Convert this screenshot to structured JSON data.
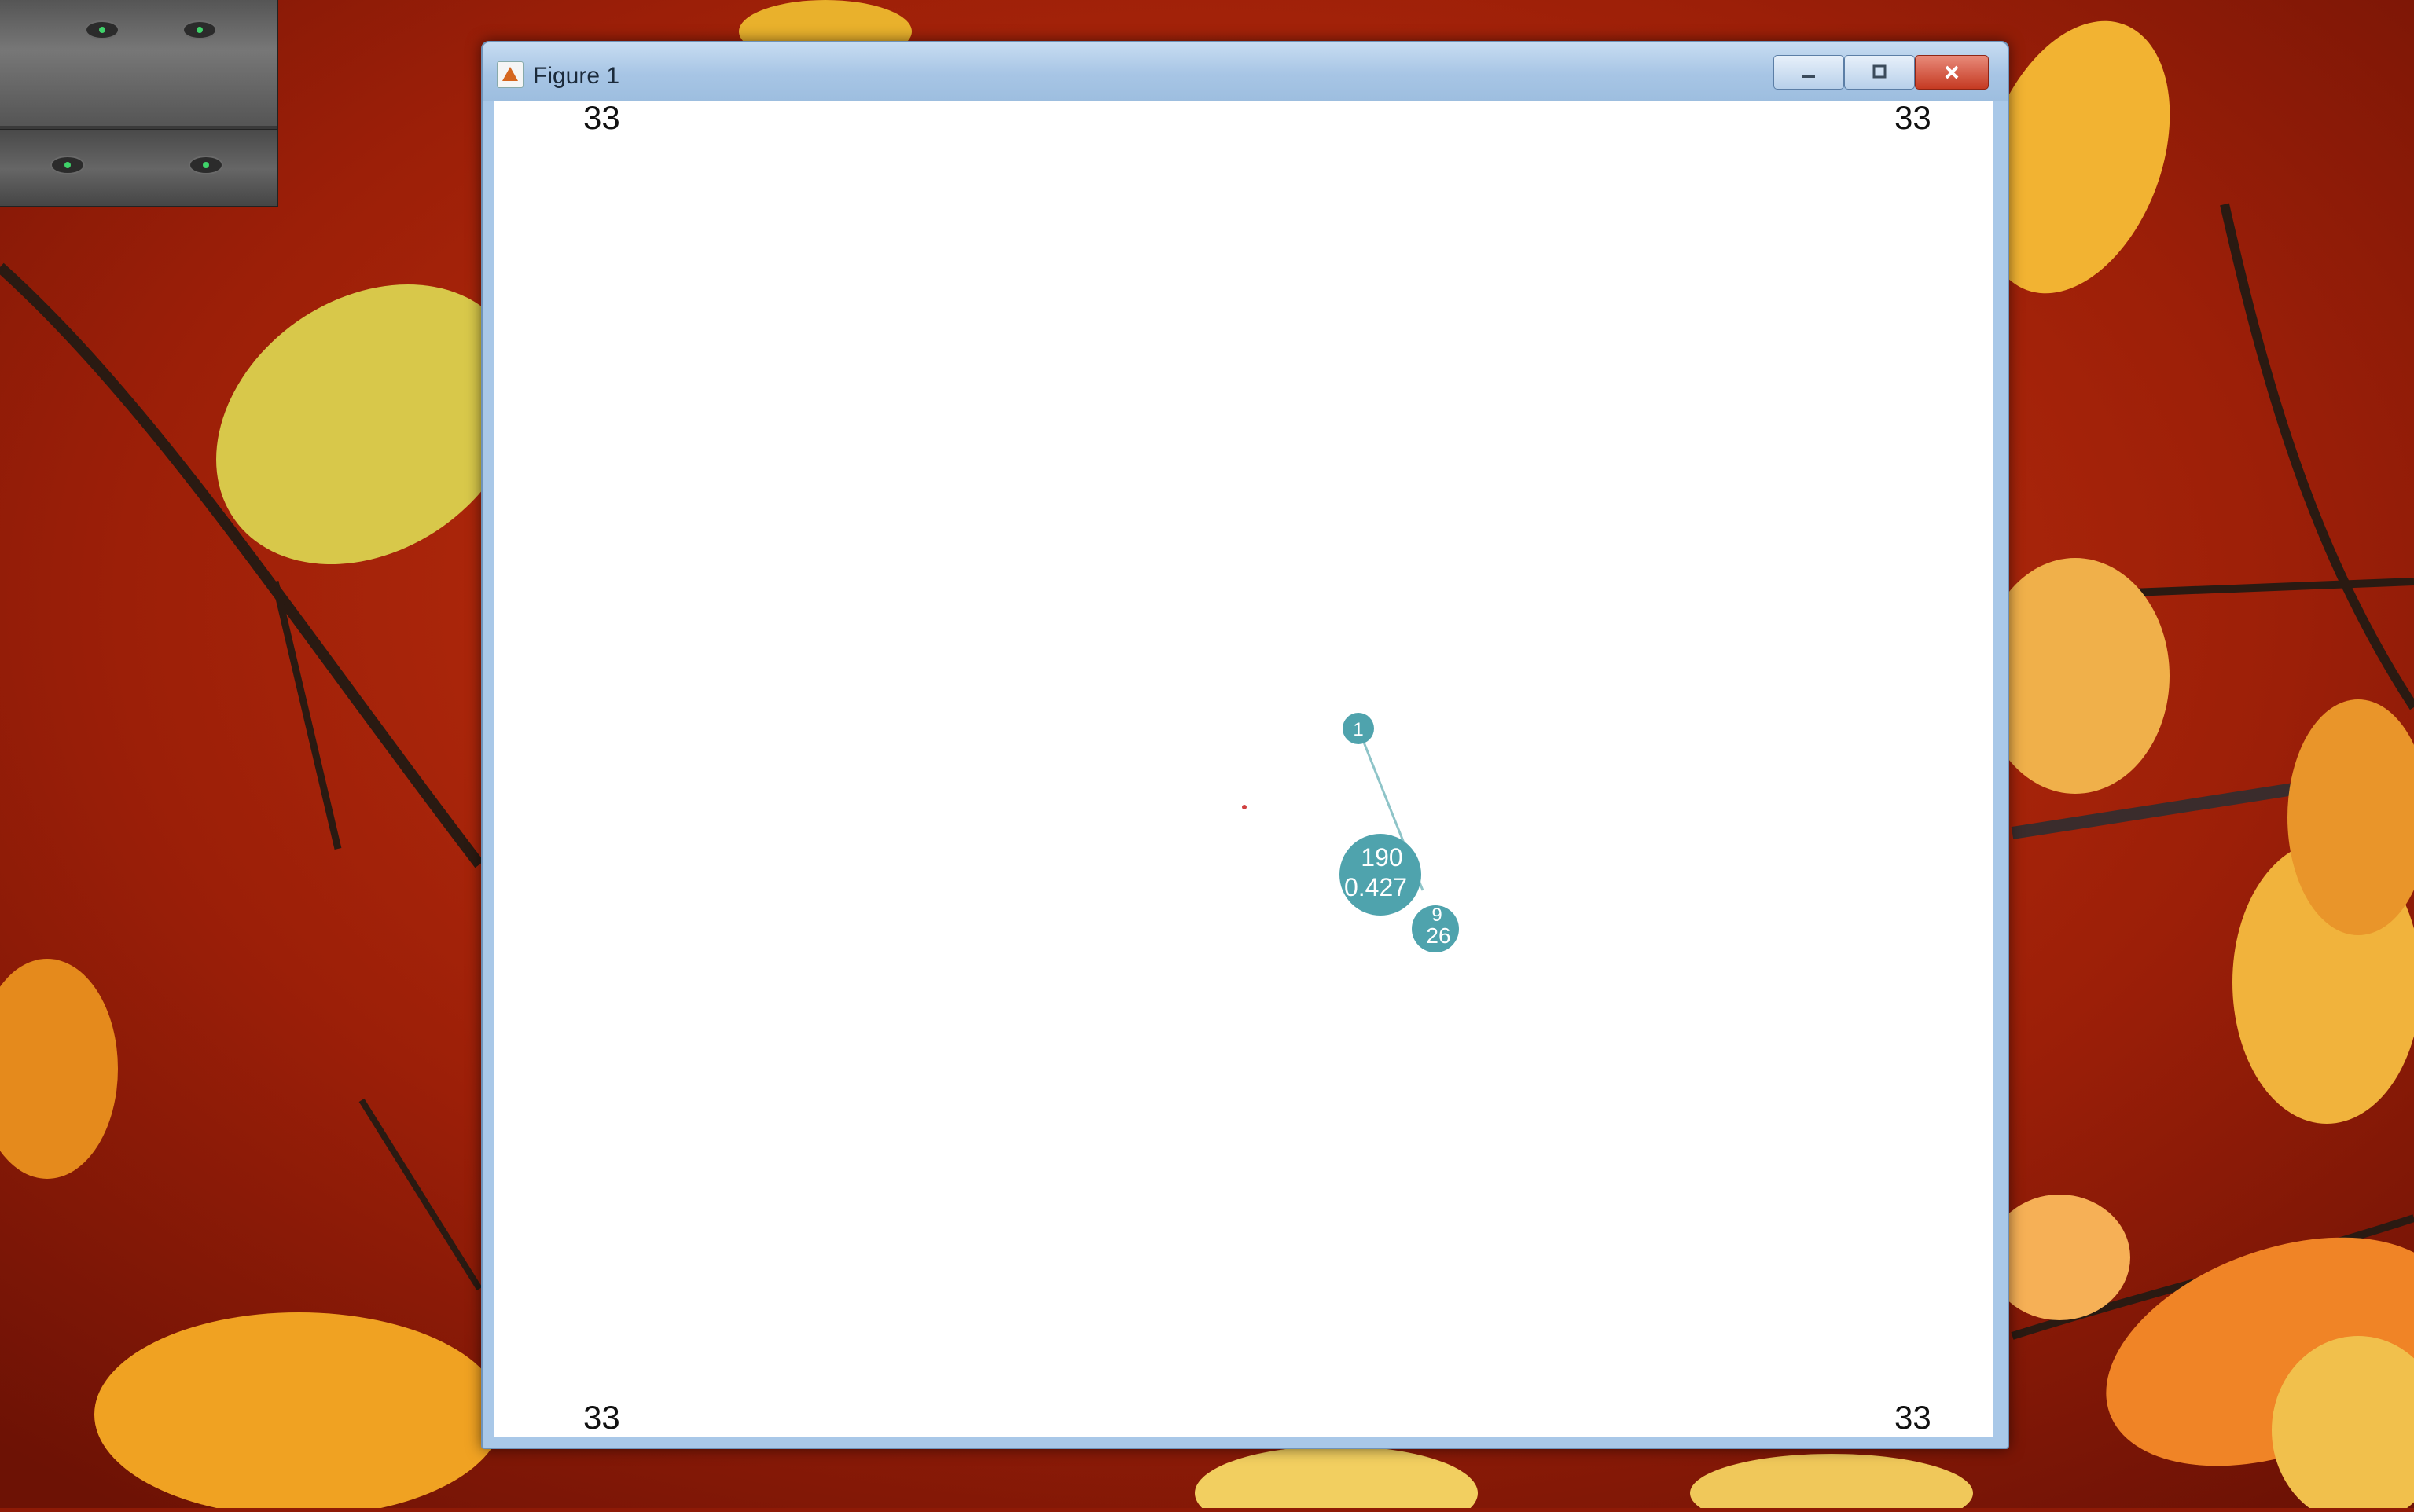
{
  "window": {
    "title": "Figure 1",
    "controls": {
      "minimize_icon": "minimize-icon",
      "maximize_icon": "maximize-icon",
      "close_icon": "close-icon"
    }
  },
  "figure": {
    "corner_labels": {
      "top_left": "33",
      "top_right": "33",
      "bottom_left": "33",
      "bottom_right": "33"
    },
    "nodes": [
      {
        "label_line1": "1",
        "label_line2": ""
      },
      {
        "label_line1": "190",
        "label_line2": "0.427"
      },
      {
        "label_line1": "9",
        "label_line2": "26"
      }
    ]
  },
  "colors": {
    "node_fill": "#4fa3ad",
    "edge": "#8ec4c8",
    "marker": "#d04040"
  },
  "webcam": {
    "icon": "webcam-preview"
  }
}
